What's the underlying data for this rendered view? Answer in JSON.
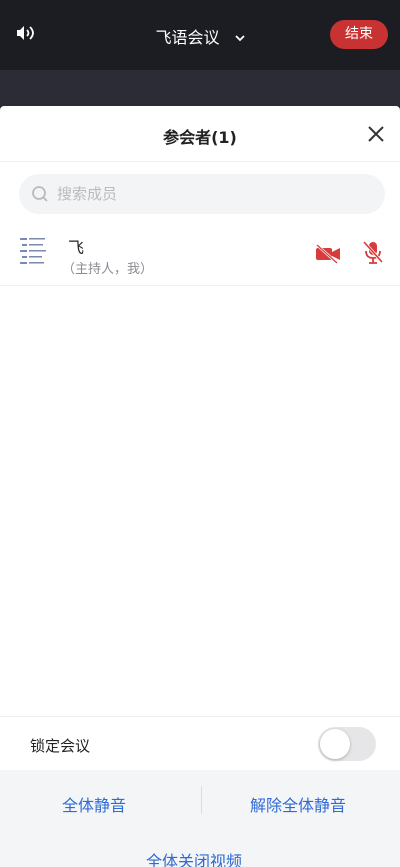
{
  "header": {
    "meeting_title": "飞语会议",
    "end_label": "结束"
  },
  "panel": {
    "title": "参会者(1)",
    "search_placeholder": "搜索成员"
  },
  "participants": [
    {
      "name": "飞",
      "role": "（主持人，我）",
      "camera": "off",
      "mic": "off"
    }
  ],
  "settings": {
    "lock_label": "锁定会议",
    "lock_enabled": false
  },
  "actions": {
    "mute_all": "全体静音",
    "unmute_all": "解除全体静音",
    "video_off_all": "全体关闭视频"
  },
  "colors": {
    "accent_red": "#d83b3b",
    "action_blue": "#2f6bd3",
    "end_button": "#c93232"
  }
}
